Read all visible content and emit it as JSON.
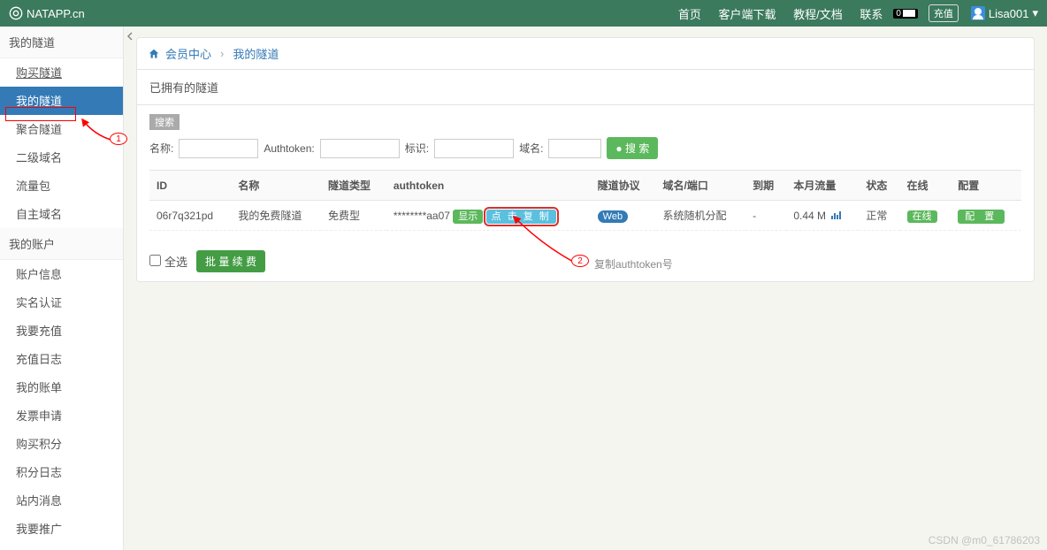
{
  "topbar": {
    "brand": "NATAPP.cn",
    "nav": [
      "首页",
      "客户端下载",
      "教程/文档",
      "联系"
    ],
    "badge_count": "0",
    "recharge": "充值",
    "username": "Lisa001",
    "caret": "▾"
  },
  "sidebar": {
    "section1": {
      "title": "我的隧道",
      "items": [
        "购买隧道",
        "我的隧道",
        "聚合隧道",
        "二级域名",
        "流量包",
        "自主域名"
      ],
      "active_index": 1
    },
    "section2": {
      "title": "我的账户",
      "items": [
        "账户信息",
        "实名认证",
        "我要充值",
        "充值日志",
        "我的账单",
        "发票申请",
        "购买积分",
        "积分日志",
        "站内消息",
        "我要推广"
      ]
    }
  },
  "breadcrumb": {
    "link1": "会员中心",
    "link2": "我的隧道"
  },
  "panel": {
    "title": "已拥有的隧道",
    "search_title": "搜索",
    "labels": {
      "name": "名称:",
      "authtoken": "Authtoken:",
      "mark": "标识:",
      "domain": "域名:"
    },
    "search_btn": "搜 索",
    "search_dot": "●"
  },
  "table": {
    "headers": [
      "ID",
      "名称",
      "隧道类型",
      "authtoken",
      "隧道协议",
      "域名/端口",
      "到期",
      "本月流量",
      "状态",
      "在线",
      "配置"
    ],
    "row": {
      "id": "06r7q321pd",
      "name": "我的免费隧道",
      "type": "免费型",
      "token": "********aa07",
      "show": "显示",
      "copy": "点 击 复 制",
      "proto": "Web",
      "domain": "系统随机分配",
      "expire": "-",
      "flow": "0.44 M",
      "chart": "📊",
      "status": "正常",
      "online": "在线",
      "config": "配 置"
    }
  },
  "footer": {
    "selectall": "全选",
    "batch": "批 量 续 费"
  },
  "annotations": {
    "n1": "1",
    "n2": "2",
    "text2": "复制authtoken号"
  },
  "watermark": "CSDN @m0_61786203"
}
